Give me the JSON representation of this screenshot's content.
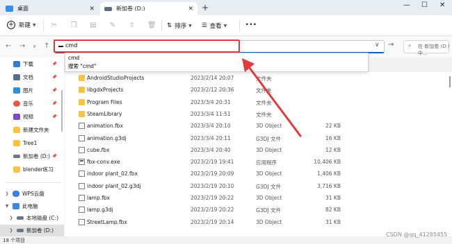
{
  "tabs": [
    {
      "label": "桌面",
      "active": false,
      "icon_color": "#3a8ee6"
    },
    {
      "label": "新加卷 (D:)",
      "active": true,
      "icon_color": "#5f6b7a"
    }
  ],
  "window_controls": {
    "minimize": "—",
    "maximize": "☐",
    "close": "✕"
  },
  "toolbar": {
    "new_label": "新建",
    "sort_label": "排序",
    "view_label": "查看",
    "more_label": "···"
  },
  "address": {
    "value": "cmd",
    "search_placeholder": "在 新加卷 (D:) 中..."
  },
  "suggestions": [
    "cmd",
    "搜索 \"cmd\""
  ],
  "sidebar": {
    "quick_items": [
      {
        "label": "下载",
        "icon_color": "#2e7dd7",
        "pinned": true
      },
      {
        "label": "文档",
        "icon_color": "#5a6d8a",
        "pinned": true
      },
      {
        "label": "图片",
        "icon_color": "#2f8fd8",
        "pinned": true
      },
      {
        "label": "音乐",
        "icon_color": "#e25b45",
        "pinned": true
      },
      {
        "label": "视频",
        "icon_color": "#7a4bc2",
        "pinned": true
      },
      {
        "label": "新建文件夹",
        "icon_color": "#f6c343",
        "pinned": false
      },
      {
        "label": "Tree1",
        "icon_color": "#f6c343",
        "pinned": false
      },
      {
        "label": "新加卷 (D:)",
        "icon_color": "#6b7785",
        "pinned": true
      },
      {
        "label": "blender练习",
        "icon_color": "#f6c343",
        "pinned": false
      }
    ],
    "tree_items": [
      {
        "label": "WPS云盘",
        "icon_color": "#3b7de0",
        "chevron": ">"
      },
      {
        "label": "此电脑",
        "icon_color": "#3b87d9",
        "chevron": "v"
      },
      {
        "label": "本地磁盘 (C:)",
        "icon_color": "#6b7785",
        "chevron": ">"
      },
      {
        "label": "新加卷 (D:)",
        "icon_color": "#6b7785",
        "chevron": ">"
      }
    ]
  },
  "files": [
    {
      "name": "AndroidStudioProjects",
      "date": "2023/2/14 20:07",
      "type": "文件夹",
      "size": "",
      "kind": "folder"
    },
    {
      "name": "libgdxProjects",
      "date": "2023/2/12 20:36",
      "type": "文件夹",
      "size": "",
      "kind": "folder"
    },
    {
      "name": "Program Files",
      "date": "2023/3/4 20:31",
      "type": "文件夹",
      "size": "",
      "kind": "folder"
    },
    {
      "name": "SteamLibrary",
      "date": "2023/3/4 11:51",
      "type": "文件夹",
      "size": "",
      "kind": "folder"
    },
    {
      "name": "animation.fbx",
      "date": "2023/3/4 20:10",
      "type": "3D Object",
      "size": "22 KB",
      "kind": "doc"
    },
    {
      "name": "animation.g3dj",
      "date": "2023/3/4 20:11",
      "type": "G3DJ 文件",
      "size": "16 KB",
      "kind": "doc"
    },
    {
      "name": "cube.fbx",
      "date": "2023/3/4 20:40",
      "type": "3D Object",
      "size": "12 KB",
      "kind": "doc"
    },
    {
      "name": "fbx-conv.exe",
      "date": "2023/2/19 19:41",
      "type": "应用程序",
      "size": "10,406 KB",
      "kind": "exe"
    },
    {
      "name": "indoor plant_02.fbx",
      "date": "2023/2/19 20:09",
      "type": "3D Object",
      "size": "1,406 KB",
      "kind": "doc"
    },
    {
      "name": "indoor plant_02.g3dj",
      "date": "2023/2/19 20:10",
      "type": "G3DJ 文件",
      "size": "3,716 KB",
      "kind": "doc"
    },
    {
      "name": "lamp.fbx",
      "date": "2023/2/19 20:22",
      "type": "3D Object",
      "size": "31 KB",
      "kind": "doc"
    },
    {
      "name": "lamp.g3dj",
      "date": "2023/2/19 20:22",
      "type": "G3DJ 文件",
      "size": "82 KB",
      "kind": "doc"
    },
    {
      "name": "StreetLamp.fbx",
      "date": "2023/2/19 20:14",
      "type": "3D Object",
      "size": "31 KB",
      "kind": "doc"
    }
  ],
  "status": {
    "item_count": "18 个项目"
  },
  "watermark": "CSDN @qq_41285455",
  "colors": {
    "annotation_red": "#e4393c",
    "accent": "#0067c0",
    "folder": "#f6c343"
  }
}
